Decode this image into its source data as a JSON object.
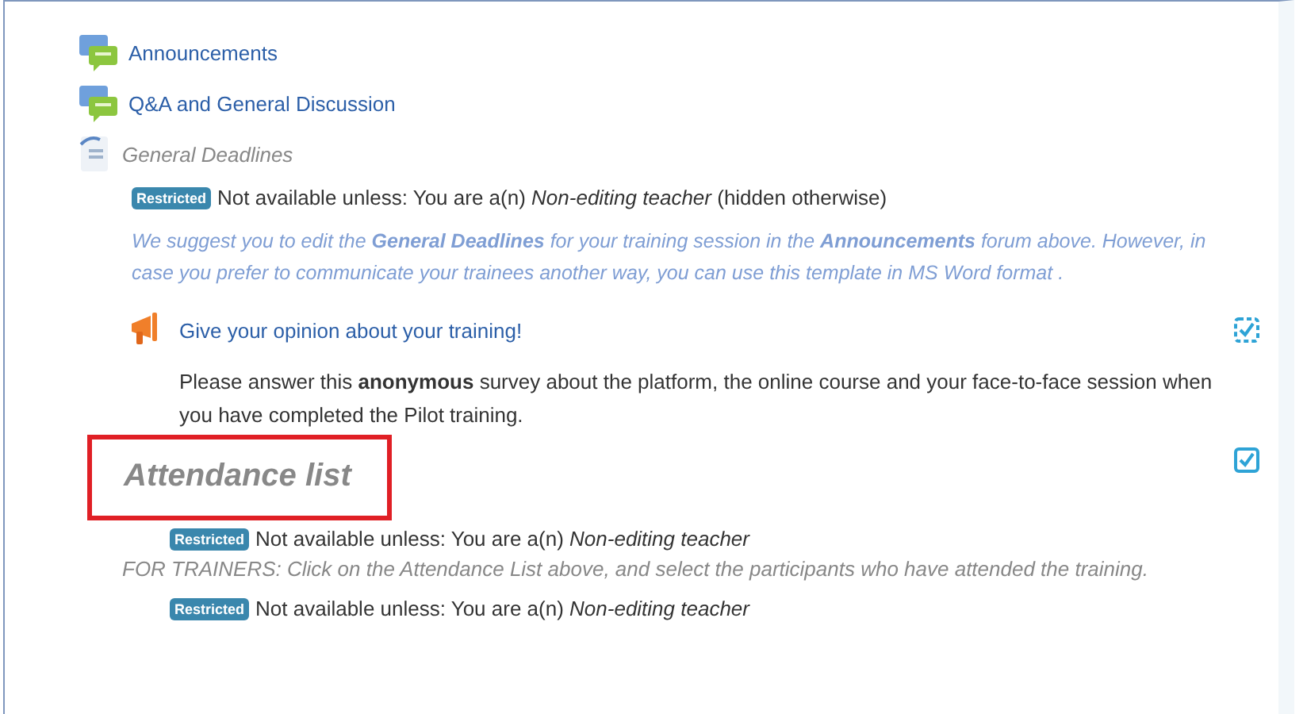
{
  "items": [
    {
      "kind": "forum",
      "name": "Announcements"
    },
    {
      "kind": "forum",
      "name": "Q&A and General Discussion"
    },
    {
      "kind": "document",
      "name": "General Deadlines"
    },
    {
      "kind": "restriction",
      "badge": "Restricted",
      "text": "Not available unless: You are a(n) *Non-editing teacher* (hidden otherwise)"
    },
    {
      "kind": "description",
      "text": "We suggest you to edit the **General Deadlines** for your training session in the **Announcements** forum above. However, in case you prefer to communicate your trainees another way, you can use this template in MS Word format ."
    },
    {
      "kind": "feedback",
      "name": "Give your opinion about your training!",
      "completion": {
        "checked": true,
        "auto": true
      }
    },
    {
      "kind": "text",
      "text": "Please answer this **anonymous** survey about the platform, the online course and your face-to-face session when you have completed the Pilot training."
    },
    {
      "kind": "heading",
      "name": "Attendance list",
      "highlighted": true,
      "completion": {
        "checked": true,
        "auto": false
      }
    },
    {
      "kind": "restriction",
      "badge": "Restricted",
      "text": "Not available unless: You are a(n) *Non-editing teacher*"
    },
    {
      "kind": "note",
      "text": "FOR TRAINERS: Click on the Attendance List above, and select the participants who have attended the training."
    },
    {
      "kind": "restriction",
      "badge": "Restricted",
      "text": "Not available unless: You are a(n) *Non-editing teacher*"
    }
  ]
}
